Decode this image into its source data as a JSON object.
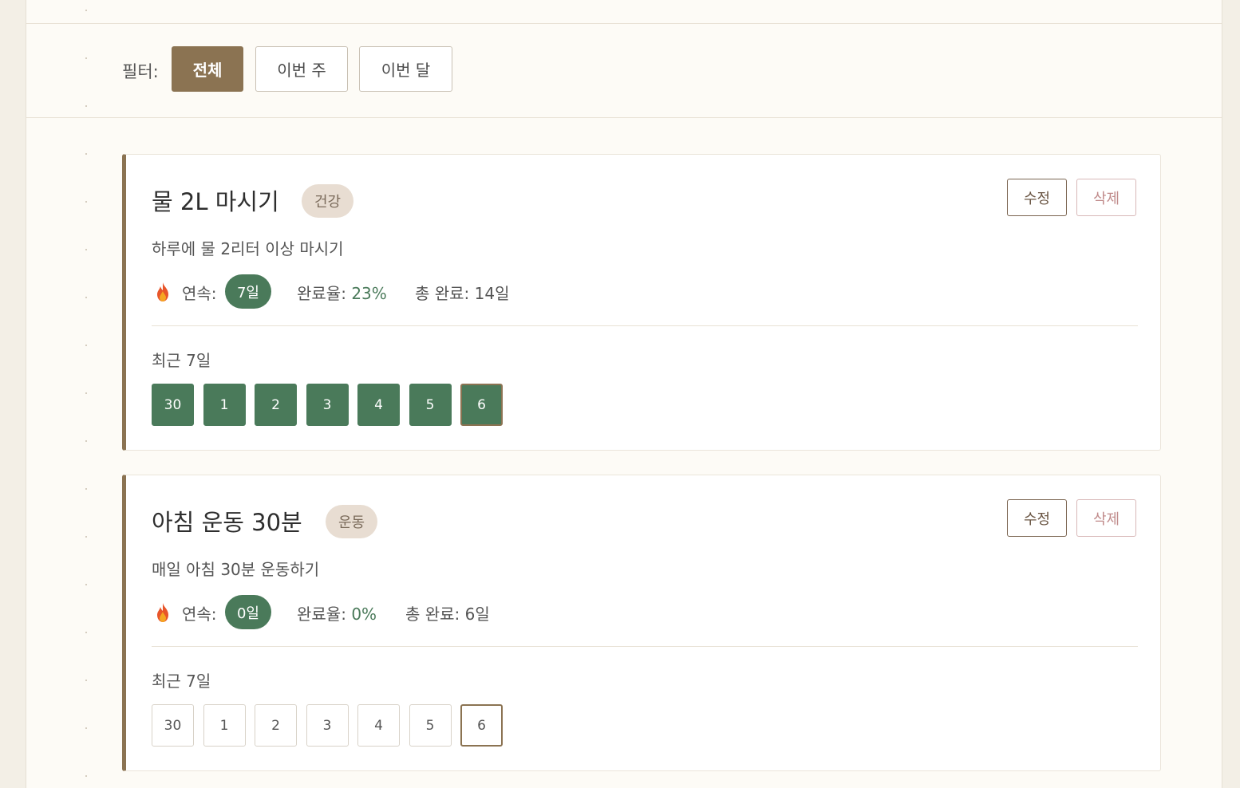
{
  "filter": {
    "label": "필터:",
    "options": [
      {
        "label": "전체",
        "active": true
      },
      {
        "label": "이번 주",
        "active": false
      },
      {
        "label": "이번 달",
        "active": false
      }
    ]
  },
  "habits": [
    {
      "title": "물 2L 마시기",
      "category": "건강",
      "description": "하루에 물 2리터 이상 마시기",
      "edit_label": "수정",
      "delete_label": "삭제",
      "streak_label": "연속:",
      "streak_value": "7일",
      "completion_label": "완료율:",
      "completion_value": "23%",
      "total_label": "총 완료:",
      "total_value": "14일",
      "recent_label": "최근 7일",
      "days": [
        "30",
        "1",
        "2",
        "3",
        "4",
        "5",
        "6"
      ],
      "done": [
        true,
        true,
        true,
        true,
        true,
        true,
        true
      ]
    },
    {
      "title": "아침 운동 30분",
      "category": "운동",
      "description": "매일 아침 30분 운동하기",
      "edit_label": "수정",
      "delete_label": "삭제",
      "streak_label": "연속:",
      "streak_value": "0일",
      "completion_label": "완료율:",
      "completion_value": "0%",
      "total_label": "총 완료:",
      "total_value": "6일",
      "recent_label": "최근 7일",
      "days": [
        "30",
        "1",
        "2",
        "3",
        "4",
        "5",
        "6"
      ],
      "done": [
        false,
        false,
        false,
        false,
        false,
        false,
        false
      ]
    }
  ],
  "icons": {
    "streak": "fire-icon"
  },
  "colors": {
    "accent": "#8b7352",
    "success": "#4a7a5a",
    "badge_bg": "#e8ddd2",
    "delete": "#c08a8a"
  }
}
